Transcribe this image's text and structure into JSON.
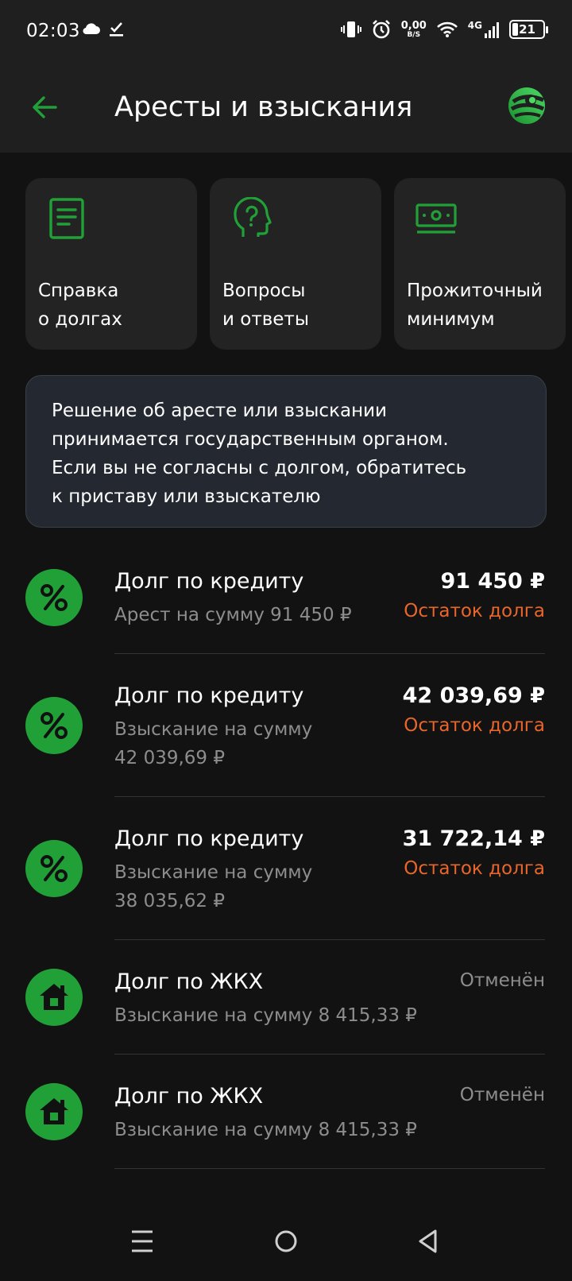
{
  "status_bar": {
    "time": "02:03",
    "net_speed_value": "0,00",
    "net_speed_unit": "B/S",
    "network_type": "4G",
    "battery": "21"
  },
  "header": {
    "title": "Аресты и взыскания"
  },
  "tiles": [
    {
      "icon": "document-icon",
      "label": "Справка\nо долгах"
    },
    {
      "icon": "question-head-icon",
      "label": "Вопросы\nи ответы"
    },
    {
      "icon": "banknote-icon",
      "label": "Прожиточный\nминимум"
    }
  ],
  "notice": {
    "text_lines": [
      "Решение об аресте или взыскании",
      "принимается государственным органом.",
      "Если вы не согласны с долгом, обратитесь",
      "к приставу или взыскателю"
    ]
  },
  "debts": [
    {
      "icon": "percent-icon",
      "title": "Долг по кредиту",
      "sub_lines": [
        "Арест на сумму 91 450 ₽"
      ],
      "amount": "91 450 ₽",
      "status": "Остаток долга",
      "status_color": "#e8652b"
    },
    {
      "icon": "percent-icon",
      "title": "Долг по кредиту",
      "sub_lines": [
        "Взыскание на сумму",
        "42 039,69 ₽"
      ],
      "amount": "42 039,69 ₽",
      "status": "Остаток долга",
      "status_color": "#e8652b"
    },
    {
      "icon": "percent-icon",
      "title": "Долг по кредиту",
      "sub_lines": [
        "Взыскание на сумму",
        "38 035,62 ₽"
      ],
      "amount": "31 722,14 ₽",
      "status": "Остаток долга",
      "status_color": "#e8652b"
    },
    {
      "icon": "house-icon",
      "title": "Долг по ЖКХ",
      "sub_lines": [
        "Взыскание на сумму 8 415,33 ₽"
      ],
      "amount": "",
      "status": "Отменён",
      "status_color": "#8d8d8d"
    },
    {
      "icon": "house-icon",
      "title": "Долг по ЖКХ",
      "sub_lines": [
        "Взыскание на сумму 8 415,33 ₽"
      ],
      "amount": "",
      "status": "Отменён",
      "status_color": "#8d8d8d"
    }
  ],
  "colors": {
    "accent": "#21a038",
    "warning": "#e8652b",
    "muted": "#8d8d8d"
  }
}
